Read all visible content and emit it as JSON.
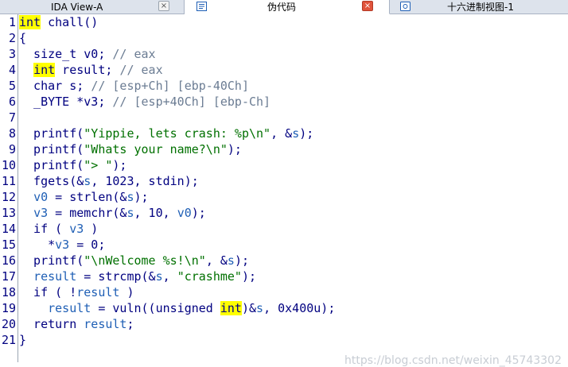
{
  "tabs": [
    {
      "label": "IDA View-A",
      "active": false
    },
    {
      "label": "伪代码",
      "active": true
    },
    {
      "label": "十六进制视图-1",
      "active": false
    }
  ],
  "close_glyph": "×",
  "lines": [
    {
      "n": "1",
      "segs": [
        {
          "t": "int",
          "c": "hl"
        },
        {
          "t": " chall()",
          "c": "kw"
        }
      ]
    },
    {
      "n": "2",
      "segs": [
        {
          "t": "{",
          "c": "kw"
        }
      ]
    },
    {
      "n": "3",
      "segs": [
        {
          "t": "  size_t v0; ",
          "c": "kw"
        },
        {
          "t": "// eax",
          "c": "cmt"
        }
      ]
    },
    {
      "n": "4",
      "segs": [
        {
          "t": "  ",
          "c": "kw"
        },
        {
          "t": "int",
          "c": "hl"
        },
        {
          "t": " result; ",
          "c": "kw"
        },
        {
          "t": "// eax",
          "c": "cmt"
        }
      ]
    },
    {
      "n": "5",
      "segs": [
        {
          "t": "  char s; ",
          "c": "kw"
        },
        {
          "t": "// [esp+Ch] [ebp-40Ch]",
          "c": "cmt"
        }
      ]
    },
    {
      "n": "6",
      "segs": [
        {
          "t": "  _BYTE *v3; ",
          "c": "kw"
        },
        {
          "t": "// [esp+40Ch] [ebp-Ch]",
          "c": "cmt"
        }
      ]
    },
    {
      "n": "7",
      "segs": []
    },
    {
      "n": "8",
      "segs": [
        {
          "t": "  printf(",
          "c": "kw"
        },
        {
          "t": "\"Yippie, lets crash: %p\\n\"",
          "c": "str"
        },
        {
          "t": ", &",
          "c": "kw"
        },
        {
          "t": "s",
          "c": "var"
        },
        {
          "t": ");",
          "c": "kw"
        }
      ]
    },
    {
      "n": "9",
      "segs": [
        {
          "t": "  printf(",
          "c": "kw"
        },
        {
          "t": "\"Whats your name?\\n\"",
          "c": "str"
        },
        {
          "t": ");",
          "c": "kw"
        }
      ]
    },
    {
      "n": "10",
      "segs": [
        {
          "t": "  printf(",
          "c": "kw"
        },
        {
          "t": "\"> \"",
          "c": "str"
        },
        {
          "t": ");",
          "c": "kw"
        }
      ]
    },
    {
      "n": "11",
      "segs": [
        {
          "t": "  fgets(&",
          "c": "kw"
        },
        {
          "t": "s",
          "c": "var"
        },
        {
          "t": ", 1023, stdin);",
          "c": "kw"
        }
      ]
    },
    {
      "n": "12",
      "segs": [
        {
          "t": "  ",
          "c": "kw"
        },
        {
          "t": "v0",
          "c": "var"
        },
        {
          "t": " = strlen(&",
          "c": "kw"
        },
        {
          "t": "s",
          "c": "var"
        },
        {
          "t": ");",
          "c": "kw"
        }
      ]
    },
    {
      "n": "13",
      "segs": [
        {
          "t": "  ",
          "c": "kw"
        },
        {
          "t": "v3",
          "c": "var"
        },
        {
          "t": " = memchr(&",
          "c": "kw"
        },
        {
          "t": "s",
          "c": "var"
        },
        {
          "t": ", 10, ",
          "c": "kw"
        },
        {
          "t": "v0",
          "c": "var"
        },
        {
          "t": ");",
          "c": "kw"
        }
      ]
    },
    {
      "n": "14",
      "segs": [
        {
          "t": "  if ( ",
          "c": "kw"
        },
        {
          "t": "v3",
          "c": "var"
        },
        {
          "t": " )",
          "c": "kw"
        }
      ]
    },
    {
      "n": "15",
      "segs": [
        {
          "t": "    *",
          "c": "kw"
        },
        {
          "t": "v3",
          "c": "var"
        },
        {
          "t": " = 0;",
          "c": "kw"
        }
      ]
    },
    {
      "n": "16",
      "segs": [
        {
          "t": "  printf(",
          "c": "kw"
        },
        {
          "t": "\"\\nWelcome %s!\\n\"",
          "c": "str"
        },
        {
          "t": ", &",
          "c": "kw"
        },
        {
          "t": "s",
          "c": "var"
        },
        {
          "t": ");",
          "c": "kw"
        }
      ]
    },
    {
      "n": "17",
      "segs": [
        {
          "t": "  ",
          "c": "kw"
        },
        {
          "t": "result",
          "c": "var"
        },
        {
          "t": " = strcmp(&",
          "c": "kw"
        },
        {
          "t": "s",
          "c": "var"
        },
        {
          "t": ", ",
          "c": "kw"
        },
        {
          "t": "\"crashme\"",
          "c": "str"
        },
        {
          "t": ");",
          "c": "kw"
        }
      ]
    },
    {
      "n": "18",
      "segs": [
        {
          "t": "  if ( !",
          "c": "kw"
        },
        {
          "t": "result",
          "c": "var"
        },
        {
          "t": " )",
          "c": "kw"
        }
      ]
    },
    {
      "n": "19",
      "segs": [
        {
          "t": "    ",
          "c": "kw"
        },
        {
          "t": "result",
          "c": "var"
        },
        {
          "t": " = vuln((unsigned ",
          "c": "kw"
        },
        {
          "t": "int",
          "c": "hl"
        },
        {
          "t": ")&",
          "c": "kw"
        },
        {
          "t": "s",
          "c": "var"
        },
        {
          "t": ", 0x400u);",
          "c": "kw"
        }
      ]
    },
    {
      "n": "20",
      "segs": [
        {
          "t": "  return ",
          "c": "kw"
        },
        {
          "t": "result",
          "c": "var"
        },
        {
          "t": ";",
          "c": "kw"
        }
      ]
    },
    {
      "n": "21",
      "segs": [
        {
          "t": "}",
          "c": "kw"
        }
      ]
    }
  ],
  "watermark": "https://blog.csdn.net/weixin_45743302"
}
